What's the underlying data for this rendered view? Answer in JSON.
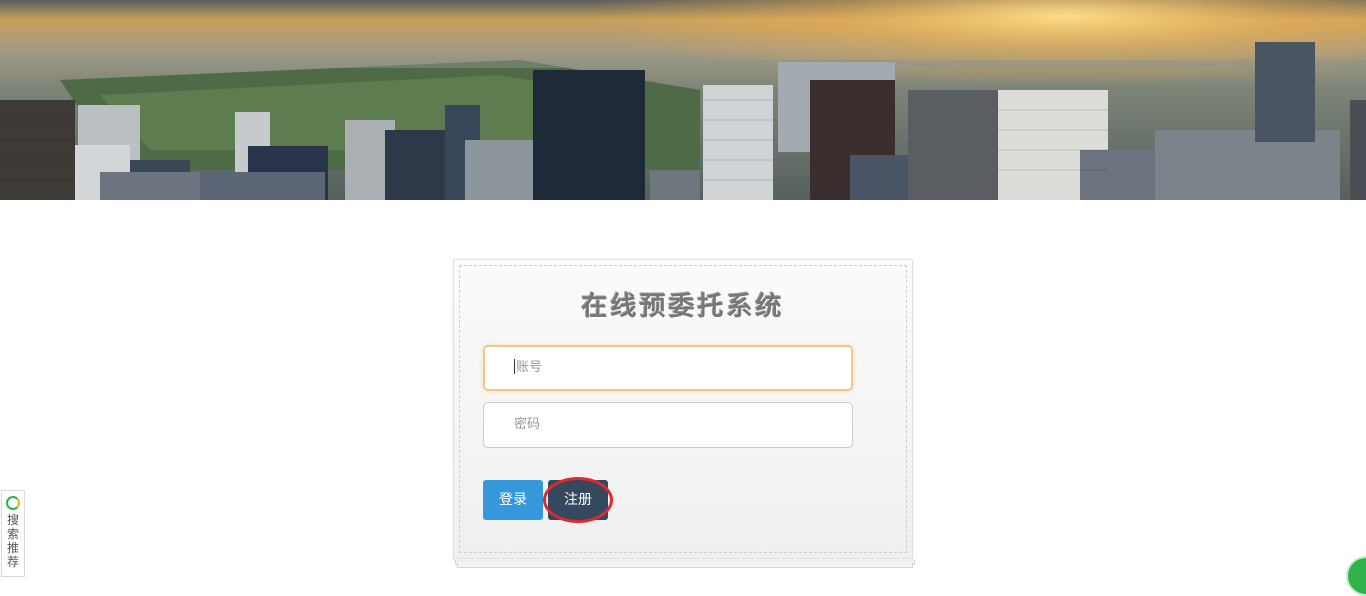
{
  "banner": {
    "image": "city-skyline-sunset"
  },
  "login_card": {
    "title": "在线预委托系统",
    "account_placeholder": "账号",
    "password_placeholder": "密码",
    "login_label": "登录",
    "register_label": "注册"
  },
  "side_widget": {
    "label": "搜索推荐",
    "icon": "search-ring-icon"
  },
  "corner_badge": {
    "icon": "green-badge-icon"
  },
  "colors": {
    "login_button": "#3498db",
    "register_button": "#34495e",
    "annotation_circle": "#e0282f",
    "focused_border": "#f0c98a"
  }
}
